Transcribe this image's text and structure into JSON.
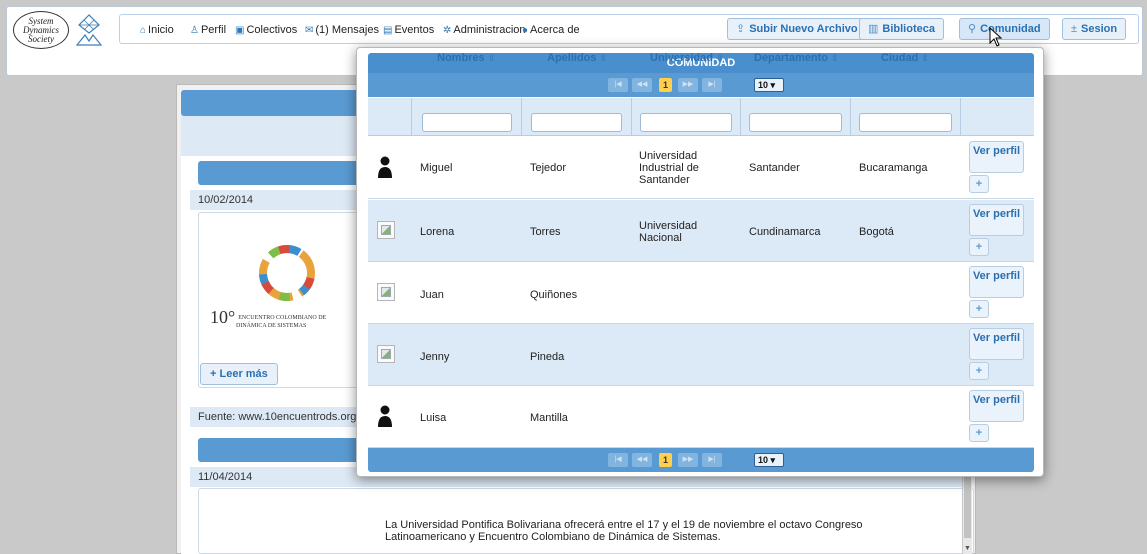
{
  "header": {
    "logo_lines": [
      "System",
      "Dynamics",
      "Society"
    ],
    "nav": [
      {
        "icon": "home-icon",
        "glyph": "⌂",
        "label": "Inicio"
      },
      {
        "icon": "user-icon",
        "glyph": "♙",
        "label": "Perfil"
      },
      {
        "icon": "collectives-icon",
        "glyph": "▣",
        "label": "Colectivos"
      },
      {
        "icon": "mail-icon",
        "glyph": "✉",
        "label": "(1) Mensajes"
      },
      {
        "icon": "calendar-icon",
        "glyph": "▤",
        "label": "Eventos"
      },
      {
        "icon": "gear-icon",
        "glyph": "✲",
        "label": "Administracion"
      },
      {
        "icon": "info-icon",
        "glyph": "●",
        "label": "Acerca de"
      }
    ],
    "buttons": {
      "upload": "Subir Nuevo Archivo",
      "library": "Biblioteca",
      "community": "Comunidad",
      "session": "Sesion"
    }
  },
  "background": {
    "date1": "10/02/2014",
    "news_logo_number": "10°",
    "news_logo_line1": "ENCUENTRO COLOMBIANO DE",
    "news_logo_line2": "DINÁMICA DE SISTEMAS",
    "read_more": "Leer más",
    "source": "Fuente: www.10encuentrods.org",
    "date2": "11/04/2014",
    "news2_text": "La Universidad Pontifica Bolivariana ofrecerá entre el 17 y el 19 de noviembre el octavo Congreso Latinoamericano y Encuentro Colombiano de Dinámica de Sistemas."
  },
  "dialog": {
    "title": "COMUNIDAD",
    "pager": {
      "page": "1",
      "page_size": "10 ▾",
      "first": "|◀",
      "prev": "◀◀",
      "next": "▶▶",
      "last": "▶|"
    },
    "columns": [
      "Nombres",
      "Apellidos",
      "Universidad",
      "Departamento",
      "Ciudad"
    ],
    "sort_glyph": "⇳",
    "view_profile": "Ver perfil",
    "add_glyph": "+",
    "rows": [
      {
        "avatar": "silhouette",
        "nombre": "Miguel",
        "apellido": "Tejedor",
        "universidad": "Universidad Industrial de Santander",
        "departamento": "Santander",
        "ciudad": "Bucaramanga"
      },
      {
        "avatar": "broken",
        "nombre": "Lorena",
        "apellido": "Torres",
        "universidad": "Universidad Nacional",
        "departamento": "Cundinamarca",
        "ciudad": "Bogotá"
      },
      {
        "avatar": "broken",
        "nombre": "Juan",
        "apellido": "Quiñones",
        "universidad": "",
        "departamento": "",
        "ciudad": ""
      },
      {
        "avatar": "broken",
        "nombre": "Jenny",
        "apellido": "Pineda",
        "universidad": "",
        "departamento": "",
        "ciudad": ""
      },
      {
        "avatar": "silhouette",
        "nombre": "Luisa",
        "apellido": "Mantilla",
        "universidad": "",
        "departamento": "",
        "ciudad": ""
      }
    ]
  },
  "colors": {
    "accent": "#4a8fcd",
    "header_band": "#5a9ad3",
    "row_alt": "#dce9f6",
    "page_number": "#ffcf4d"
  }
}
